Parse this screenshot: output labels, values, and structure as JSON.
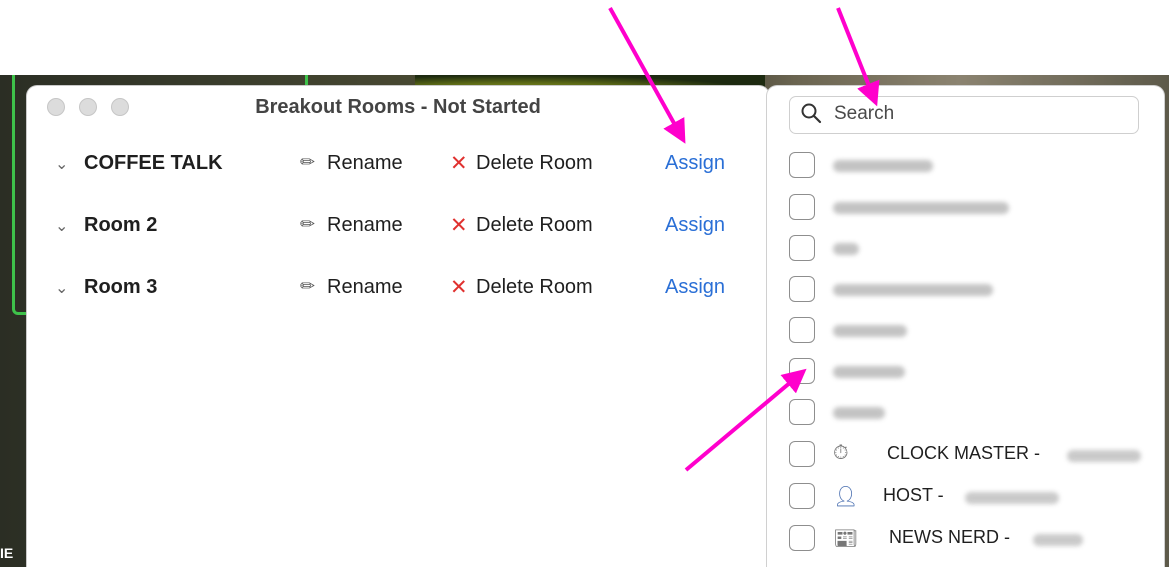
{
  "window": {
    "title": "Breakout Rooms - Not Started"
  },
  "rooms": [
    {
      "name": "COFFEE TALK",
      "rename_label": "Rename",
      "delete_label": "Delete Room",
      "assign_label": "Assign"
    },
    {
      "name": "Room 2",
      "rename_label": "Rename",
      "delete_label": "Delete Room",
      "assign_label": "Assign"
    },
    {
      "name": "Room 3",
      "rename_label": "Rename",
      "delete_label": "Delete Room",
      "assign_label": "Assign"
    }
  ],
  "assign_popover": {
    "search": {
      "placeholder": "Search"
    },
    "participants": [
      {
        "label": "",
        "checked": false
      },
      {
        "label": "",
        "checked": false
      },
      {
        "label": "",
        "checked": false
      },
      {
        "label": "",
        "checked": false
      },
      {
        "label": "",
        "checked": false
      },
      {
        "label": "",
        "checked": false
      },
      {
        "label": "",
        "checked": false
      },
      {
        "label": "CLOCK MASTER -",
        "icon": "stopwatch-icon",
        "checked": false
      },
      {
        "label": "HOST -",
        "icon": "person-icon",
        "checked": false
      },
      {
        "label": "NEWS NERD -",
        "icon": "newspaper-icon",
        "checked": false
      }
    ]
  },
  "colors": {
    "assign_link": "#2a6fd6",
    "delete_x": "#e0312f",
    "annotation_arrow": "#ff00cc",
    "video_border": "#3ec24a"
  },
  "background": {
    "edge_text": "IE"
  }
}
